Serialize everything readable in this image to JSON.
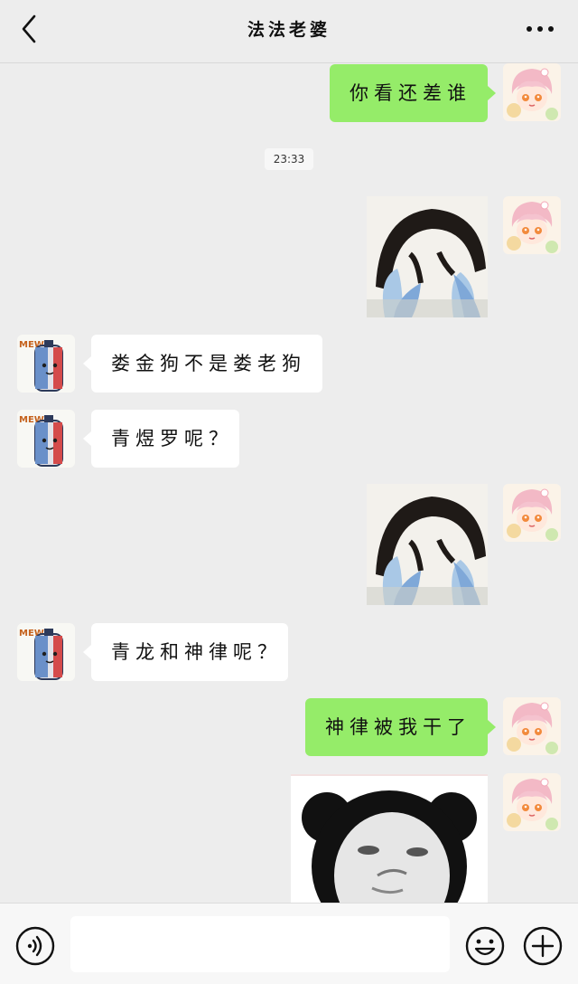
{
  "header": {
    "title": "法法老婆",
    "back_icon": "chevron-left-icon",
    "more_icon": "more-dots-icon"
  },
  "timestamp": "23:33",
  "messages": [
    {
      "sender": "self",
      "type": "text",
      "text": "你看还差谁"
    },
    {
      "sender": "self",
      "type": "sticker",
      "sticker": "penguin-cry-sticker"
    },
    {
      "sender": "other",
      "type": "text",
      "text": "娄金狗不是娄老狗"
    },
    {
      "sender": "other",
      "type": "text",
      "text": "青煜罗呢？"
    },
    {
      "sender": "self",
      "type": "sticker",
      "sticker": "penguin-cry-sticker"
    },
    {
      "sender": "other",
      "type": "text",
      "text": "青龙和神律呢？"
    },
    {
      "sender": "self",
      "type": "text",
      "text": "神律被我干了"
    },
    {
      "sender": "self",
      "type": "sticker",
      "sticker": "panda-face-sticker"
    }
  ],
  "inputbar": {
    "voice_icon": "voice-icon",
    "input_value": "",
    "emoji_icon": "emoji-icon",
    "plus_icon": "plus-icon"
  },
  "colors": {
    "background": "#ededed",
    "self_bubble": "#95ec69",
    "other_bubble": "#ffffff"
  }
}
